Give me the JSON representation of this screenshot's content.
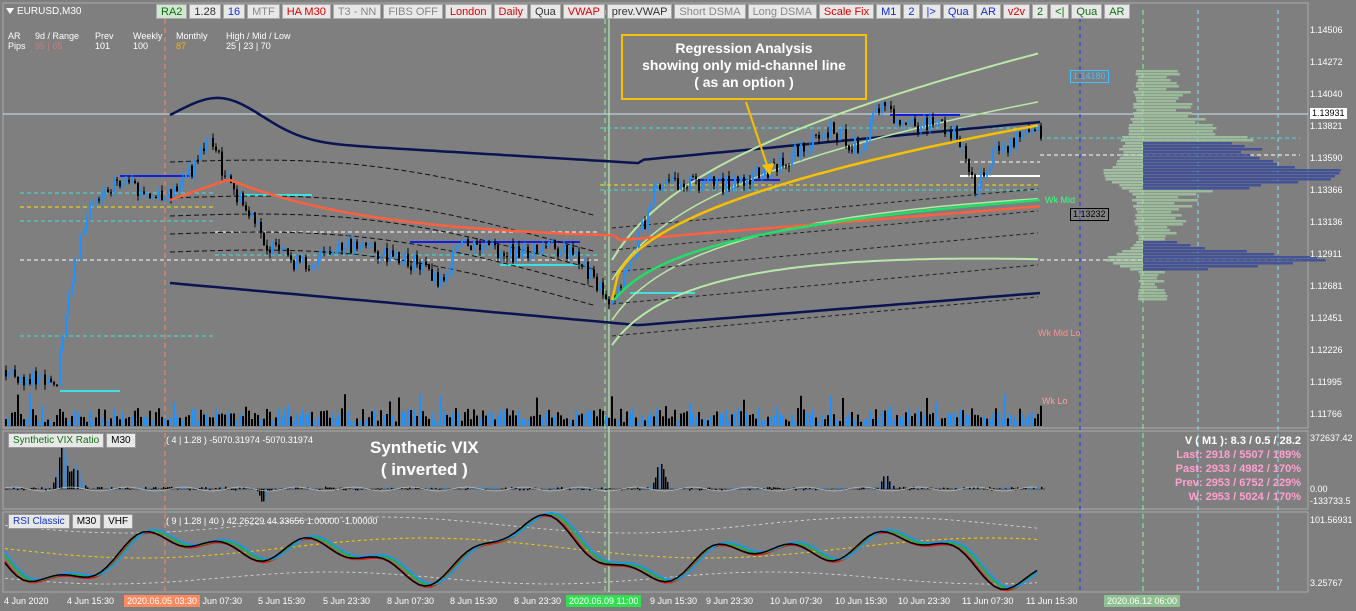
{
  "symbol": "EURUSD,M30",
  "toolbar": [
    {
      "label": "RA2",
      "style": "green on"
    },
    {
      "label": "1.28",
      "style": ""
    },
    {
      "label": "16",
      "style": "blue"
    },
    {
      "label": "MTF",
      "style": "gray"
    },
    {
      "label": "HA M30",
      "style": "red"
    },
    {
      "label": "T3 - NN",
      "style": "gray"
    },
    {
      "label": "FIBS OFF",
      "style": "gray"
    },
    {
      "label": "London",
      "style": "red"
    },
    {
      "label": "Daily",
      "style": "red"
    },
    {
      "label": "Qua",
      "style": ""
    },
    {
      "label": "VWAP",
      "style": "red"
    },
    {
      "label": "prev.VWAP",
      "style": ""
    },
    {
      "label": "Short DSMA",
      "style": "gray"
    },
    {
      "label": "Long DSMA",
      "style": "gray"
    },
    {
      "label": "Scale Fix",
      "style": "red"
    },
    {
      "label": "M1",
      "style": "blue"
    },
    {
      "label": "2",
      "style": "blue"
    },
    {
      "label": "|>",
      "style": "blue"
    },
    {
      "label": "Qua",
      "style": "blue"
    },
    {
      "label": "AR",
      "style": "blue"
    },
    {
      "label": "v2v",
      "style": "red"
    },
    {
      "label": "2",
      "style": "green"
    },
    {
      "label": "<|",
      "style": "green"
    },
    {
      "label": "Qua",
      "style": "green"
    },
    {
      "label": "AR",
      "style": "green"
    }
  ],
  "stats": {
    "row1": [
      "AR",
      "9d / Range",
      "Prev",
      "Weekly",
      "Monthly",
      "High / Mid / Low"
    ],
    "row2": [
      "Pips",
      "95 | 65",
      "101",
      "100",
      "87",
      "25 | 23 | 70"
    ]
  },
  "annotation": {
    "line1": "Regression Analysis",
    "line2": "showing only mid-channel line",
    "line3": "( as an option )"
  },
  "vix_label": {
    "line1": "Synthetic VIX",
    "line2": "( inverted )"
  },
  "vix_panel": {
    "name": "Synthetic VIX Ratio",
    "tf": "M30",
    "info": "( 4 | 1.28 ) -5070.31974 -5070.31974",
    "y_top": "372637.42",
    "y_mid": "0.00",
    "y_bot": "-133733.5"
  },
  "vstats": {
    "head": "V ( M1 ): 8.3 / 0.5 / 28.2",
    "last": "Last: 2918 / 5507 / 189%",
    "past": "Past: 2933 / 4982 / 170%",
    "prev": "Prev: 2953 / 6752 / 229%",
    "w": "W: 2953 / 5024 / 170%"
  },
  "rsi_panel": {
    "name": "RSI Classic",
    "tf": "M30",
    "extra": "VHF",
    "info": "( 9 | 1.28 | 40 ) 42.26229 44.33656 1.00000 -1.00000",
    "y_top": "101.56931",
    "y_bot": "3.25767"
  },
  "yaxis": [
    "1.14506",
    "1.14272",
    "1.14040",
    "1.13821",
    "1.13590",
    "1.13366",
    "1.13136",
    "1.12911",
    "1.12681",
    "1.12451",
    "1.12226",
    "1.11995",
    "1.11766"
  ],
  "price_boxes": {
    "current": "1.13931",
    "p1": "1.14180",
    "p2": "1.13232"
  },
  "wk_labels": {
    "mid": "Wk Mid",
    "mid_lo": "Wk Mid Lo",
    "lo": "Wk Lo"
  },
  "xaxis": [
    "4 Jun 2020",
    "4 Jun 15:30",
    "5 Jun 07:30",
    "5 Jun 15:30",
    "5 Jun 23:30",
    "8 Jun 07:30",
    "8 Jun 15:30",
    "8 Jun 23:30",
    "9 Jun 15:30",
    "9 Jun 23:30",
    "10 Jun 07:30",
    "10 Jun 15:30",
    "10 Jun 23:30",
    "11 Jun 07:30",
    "11 Jun 15:30"
  ],
  "x_highlights": {
    "a": "2020.06.05 03:30",
    "b": "2020.06.09 11:00",
    "c": "2020.06.12 06:00"
  },
  "colors": {
    "bg": "#7f7f7f",
    "bull": "#1e90ff",
    "bear": "#000000",
    "regression": "#f7c000",
    "ma_red": "#ff6040",
    "green": "#22dd66",
    "navy": "#0a1450"
  }
}
